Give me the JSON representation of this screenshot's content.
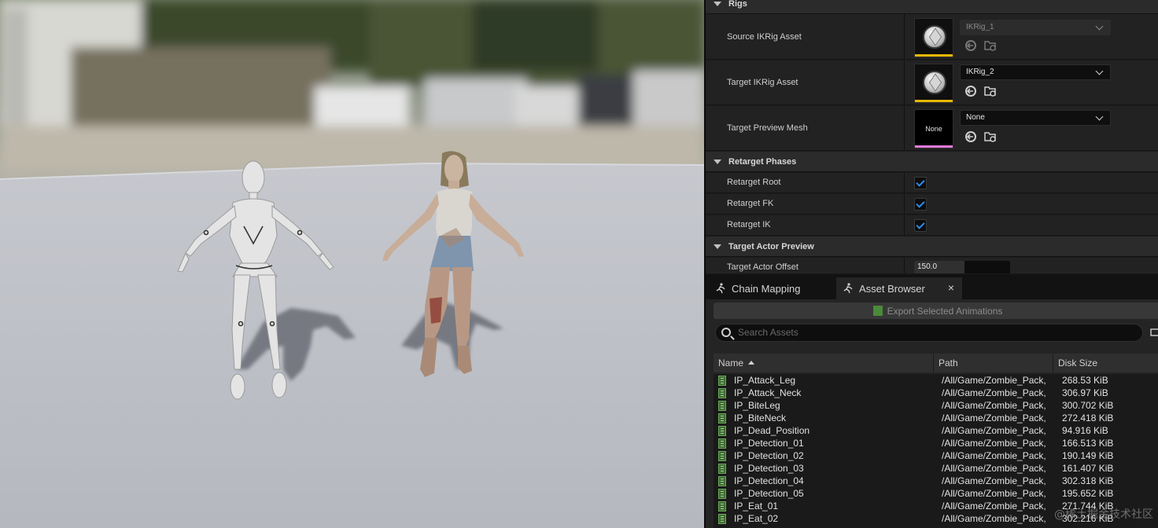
{
  "details": {
    "rigs": {
      "header": "Rigs",
      "source": {
        "label": "Source IKRig Asset",
        "value": "IKRig_1"
      },
      "target": {
        "label": "Target IKRig Asset",
        "value": "IKRig_2"
      },
      "preview_mesh": {
        "label": "Target Preview Mesh",
        "value": "None",
        "thumb_text": "None"
      }
    },
    "phases": {
      "header": "Retarget Phases",
      "items": [
        {
          "label": "Retarget Root",
          "checked": true
        },
        {
          "label": "Retarget FK",
          "checked": true
        },
        {
          "label": "Retarget IK",
          "checked": true
        }
      ]
    },
    "target_preview": {
      "header": "Target Actor Preview",
      "offset_label": "Target Actor Offset",
      "offset_value": "150.0"
    }
  },
  "tabs": [
    {
      "label": "Chain Mapping",
      "icon": "running-figure-icon",
      "active": false
    },
    {
      "label": "Asset Browser",
      "icon": "running-figure-icon",
      "active": true,
      "close": "×"
    }
  ],
  "browser": {
    "export_label": "Export Selected Animations",
    "search_placeholder": "Search Assets",
    "columns": {
      "name": "Name",
      "path": "Path",
      "size": "Disk Size"
    },
    "rows": [
      {
        "name": "IP_Attack_Leg",
        "path": "/All/Game/Zombie_Pack,",
        "size": "268.53 KiB"
      },
      {
        "name": "IP_Attack_Neck",
        "path": "/All/Game/Zombie_Pack,",
        "size": "306.97 KiB"
      },
      {
        "name": "IP_BiteLeg",
        "path": "/All/Game/Zombie_Pack,",
        "size": "300.702 KiB"
      },
      {
        "name": "IP_BiteNeck",
        "path": "/All/Game/Zombie_Pack,",
        "size": "272.418 KiB"
      },
      {
        "name": "IP_Dead_Position",
        "path": "/All/Game/Zombie_Pack,",
        "size": "94.916 KiB"
      },
      {
        "name": "IP_Detection_01",
        "path": "/All/Game/Zombie_Pack,",
        "size": "166.513 KiB"
      },
      {
        "name": "IP_Detection_02",
        "path": "/All/Game/Zombie_Pack,",
        "size": "190.149 KiB"
      },
      {
        "name": "IP_Detection_03",
        "path": "/All/Game/Zombie_Pack,",
        "size": "161.407 KiB"
      },
      {
        "name": "IP_Detection_04",
        "path": "/All/Game/Zombie_Pack,",
        "size": "302.318 KiB"
      },
      {
        "name": "IP_Detection_05",
        "path": "/All/Game/Zombie_Pack,",
        "size": "195.652 KiB"
      },
      {
        "name": "IP_Eat_01",
        "path": "/All/Game/Zombie_Pack,",
        "size": "271.744 KiB"
      },
      {
        "name": "IP_Eat_02",
        "path": "/All/Game/Zombie_Pack,",
        "size": "302.216 KiB"
      }
    ]
  },
  "watermark": "@稀土掘金技术社区",
  "colors": {
    "panel_bg": "#1a1a1a",
    "category_bg": "#2b2b2b",
    "checkbox_accent": "#2d8ceb",
    "ikrig_bar": "#e8b800",
    "mesh_bar": "#e07ad8"
  }
}
